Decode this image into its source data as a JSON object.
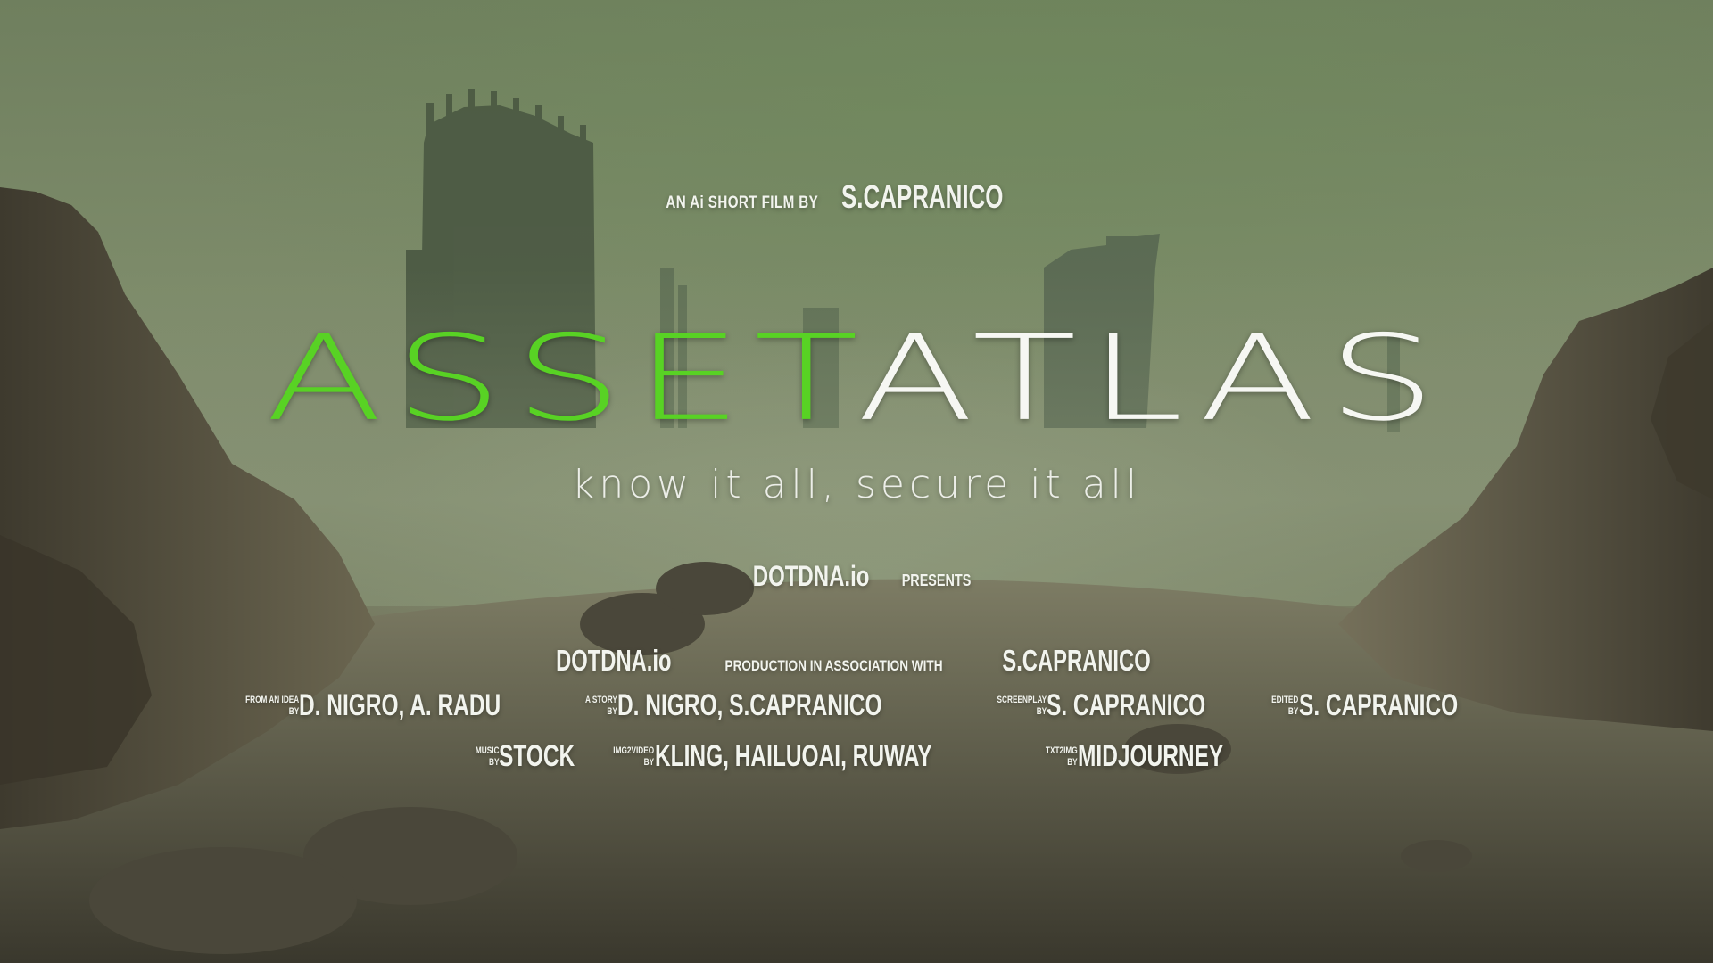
{
  "top_credit": {
    "prefix": "AN Ai SHORT FILM BY",
    "author": "S.CAPRANICO"
  },
  "title": {
    "part1": "ASSET",
    "part2": "ATLAS",
    "part1_color": "#58d224",
    "part2_color": "#f6f7f3"
  },
  "tagline": "know it all, secure it all",
  "presents": {
    "company": "DOTDNA.io",
    "label": "PRESENTS"
  },
  "production": {
    "company": "DOTDNA.io",
    "mid": "PRODUCTION IN ASSOCIATION WITH",
    "partner": "S.CAPRANICO"
  },
  "credits_row2": [
    {
      "role_top": "FROM AN IDEA",
      "role_bottom": "BY",
      "name": "D. NIGRO, A. RADU"
    },
    {
      "role_top": "A STORY",
      "role_bottom": "BY",
      "name": "D. NIGRO, S.CAPRANICO"
    },
    {
      "role_top": "SCREENPLAY",
      "role_bottom": "BY",
      "name": "S. CAPRANICO"
    },
    {
      "role_top": "EDITED",
      "role_bottom": "BY",
      "name": "S. CAPRANICO"
    }
  ],
  "credits_row3": [
    {
      "role_top": "MUSIC",
      "role_bottom": "BY",
      "name": "STOCK"
    },
    {
      "role_top": "IMG2VIDEO",
      "role_bottom": "BY",
      "name": "KLING, HAILUOAI, RUWAY"
    },
    {
      "role_top": "TXT2IMG",
      "role_bottom": "BY",
      "name": "MIDJOURNEY"
    }
  ]
}
